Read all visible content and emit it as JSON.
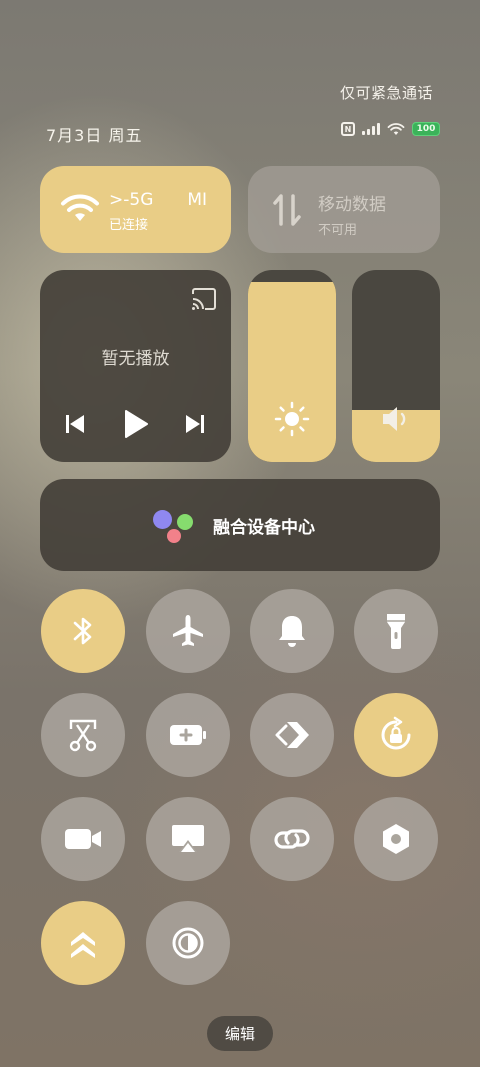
{
  "status_bar": {
    "emergency_text": "仅可紧急通话",
    "date_text": "7月3日 周五",
    "battery_level": "100",
    "icons": [
      "nfc-icon",
      "signal-icon",
      "wifi-icon",
      "battery-icon"
    ]
  },
  "wifi_tile": {
    "ssid": ">-5G",
    "ssid_extra": "MI",
    "status": "已连接",
    "active": true
  },
  "mobile_data_tile": {
    "label": "移动数据",
    "status": "不可用",
    "active": false
  },
  "media": {
    "title": "暂无播放"
  },
  "sliders": {
    "brightness_level": 0.94,
    "volume_level": 0.27
  },
  "fusion": {
    "label": "融合设备中心"
  },
  "toggles": [
    {
      "name": "bluetooth",
      "active": true
    },
    {
      "name": "airplane",
      "active": false
    },
    {
      "name": "bell",
      "active": false
    },
    {
      "name": "flashlight",
      "active": false
    },
    {
      "name": "screenshot",
      "active": false
    },
    {
      "name": "battery-saver",
      "active": false
    },
    {
      "name": "cast",
      "active": false
    },
    {
      "name": "rotation-lock",
      "active": true
    },
    {
      "name": "screen-record",
      "active": false
    },
    {
      "name": "screen-mirror",
      "active": false
    },
    {
      "name": "link",
      "active": false
    },
    {
      "name": "nfc-hex",
      "active": false
    },
    {
      "name": "performance",
      "active": true
    },
    {
      "name": "eye-comfort",
      "active": false
    }
  ],
  "edit_button": {
    "label": "编辑"
  },
  "colors": {
    "accent": "#e9cd86",
    "inactive": "#aaa59d",
    "dark_tile": "#423e37"
  }
}
